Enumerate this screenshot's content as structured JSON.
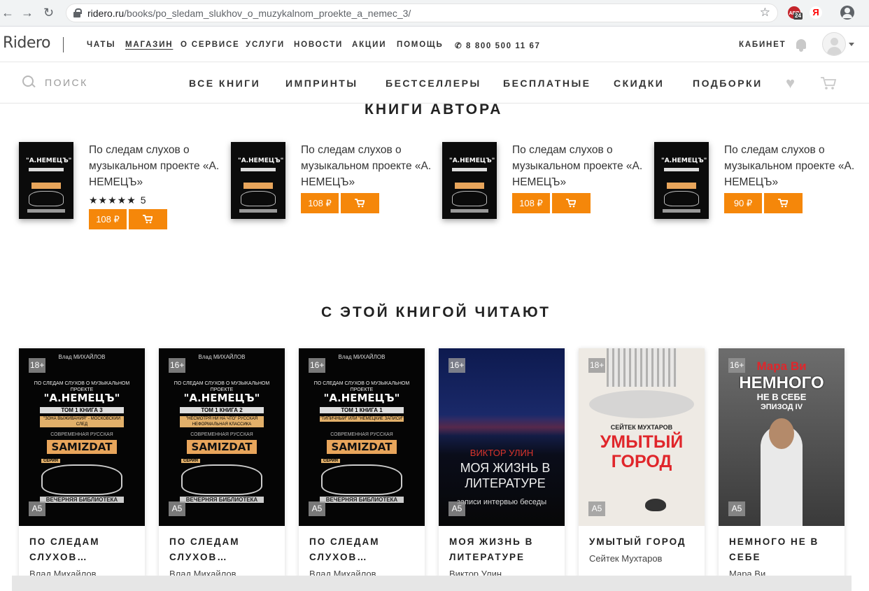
{
  "browser": {
    "url_host": "ridero.ru",
    "url_path": "/books/po_sledam_slukhov_o_muzykalnom_proekte_a_nemec_3/",
    "ext_abp_label": "ABP",
    "ext_abp_count": "24",
    "ext_ya_label": "Я"
  },
  "site": {
    "logo": "Ridero",
    "topnav": [
      "ЧАТЫ",
      "МАГАЗИН",
      "О СЕРВИСЕ",
      "УСЛУГИ",
      "НОВОСТИ",
      "АКЦИИ",
      "ПОМОЩЬ"
    ],
    "phone": "8 800 500 11 67",
    "cabinet": "КАБИНЕТ",
    "search_label": "ПОИСК",
    "shopnav": [
      "ВСЕ КНИГИ",
      "ИМПРИНТЫ",
      "БЕСТСЕЛЛЕРЫ",
      "БЕСПЛАТНЫЕ",
      "СКИДКИ",
      "ПОДБОРКИ"
    ]
  },
  "author_books": {
    "heading": "КНИГИ АВТОРА",
    "items": [
      {
        "title": "По следам слухов о музыкальном проекте «А. НЕМЕЦЪ»",
        "rating_stars": "★★★★★",
        "rating_count": "5",
        "price": "108 ₽",
        "cover_volume": "3"
      },
      {
        "title": "По следам слухов о музыкальном проекте «А. НЕМЕЦЪ»",
        "price": "108 ₽",
        "cover_volume": "3"
      },
      {
        "title": "По следам слухов о музыкальном проекте «А. НЕМЕЦЪ»",
        "price": "108 ₽",
        "cover_volume": "4"
      },
      {
        "title": "По следам слухов о музыкальном проекте «А. НЕМЕЦЪ»",
        "price": "90 ₽",
        "cover_volume": "1"
      }
    ]
  },
  "read_with": {
    "heading": "С ЭТОЙ КНИГОЙ ЧИТАЮТ",
    "items": [
      {
        "age": "18+",
        "format": "A5",
        "title": "ПО СЛЕДАМ СЛУХОВ…",
        "author": "Влад Михайлов",
        "cover": {
          "author": "Влад МИХАЙЛОВ",
          "line1": "ПО СЛЕДАМ СЛУХОВ О МУЗЫКАЛЬНОМ ПРОЕКТЕ",
          "name": "\"А.НЕМЕЦЪ\"",
          "vol": "ТОМ 1 КНИГА 3",
          "sub": "\"ЗОНА ВЫЖИВАНИЯ\" - МОСКОВСКИЙ СЛЕД",
          "series_top": "СОВРЕМЕННАЯ РУССКАЯ",
          "series": "SAMIZDAT",
          "seria": "СЕРИЯ",
          "library": "ВЕЧЕРНЯЯ БИБЛИОТЕКА"
        }
      },
      {
        "age": "16+",
        "format": "A5",
        "title": "ПО СЛЕДАМ СЛУХОВ…",
        "author": "Влад Михайлов",
        "cover": {
          "author": "Влад МИХАЙЛОВ",
          "line1": "ПО СЛЕДАМ СЛУХОВ О МУЗЫКАЛЬНОМ ПРОЕКТЕ",
          "name": "\"А.НЕМЕЦЪ\"",
          "vol": "ТОМ 1 КНИГА 2",
          "sub": "\"НЕСМОТРЯ НИ НА ЧТО\" РУССКАЯ НЕФОРМАЛЬНАЯ КЛАССИКА",
          "series_top": "СОВРЕМЕННАЯ РУССКАЯ",
          "series": "SAMIZDAT",
          "seria": "СЕРИЯ",
          "library": "ВЕЧЕРНЯЯ БИБЛИОТЕКА"
        }
      },
      {
        "age": "16+",
        "format": "A5",
        "title": "ПО СЛЕДАМ СЛУХОВ…",
        "author": "Влад Михайлов",
        "cover": {
          "author": "Влад МИХАЙЛОВ",
          "line1": "ПО СЛЕДАМ СЛУХОВ О МУЗЫКАЛЬНОМ ПРОЕКТЕ",
          "name": "\"А.НЕМЕЦЪ\"",
          "vol": "ТОМ 1 КНИГА 1",
          "sub": "\"ТИПИЧНЫЙ\" ИЛИ \"НЕМЕЦКИЕ ЗАПИСИ\"",
          "series_top": "СОВРЕМЕННАЯ РУССКАЯ",
          "series": "SAMIZDAT",
          "seria": "СЕРИЯ",
          "library": "ВЕЧЕРНЯЯ БИБЛИОТЕКА"
        }
      },
      {
        "age": "16+",
        "format": "A5",
        "title": "МОЯ ЖИЗНЬ В ЛИТЕРАТУРЕ",
        "author": "Виктор Улин",
        "cover": {
          "author": "ВИКТОР УЛИН",
          "title": "МОЯ ЖИЗНЬ В ЛИТЕРАТУРЕ",
          "sub": "записи интервью беседы"
        }
      },
      {
        "age": "18+",
        "format": "A5",
        "title": "УМЫТЫЙ ГОРОД",
        "author": "Сейтек Мухтаров",
        "cover": {
          "author": "СЕЙТЕК МУХТАРОВ",
          "title": "УМЫТЫЙ ГОРОД"
        }
      },
      {
        "age": "16+",
        "format": "A5",
        "title": "НЕМНОГО НЕ В СЕБЕ",
        "author": "Мара Ви",
        "cover": {
          "author": "Мара Ви",
          "title": "НЕМНОГО",
          "title2": "НЕ В СЕБЕ",
          "episode": "ЭПИЗОД IV"
        }
      }
    ]
  },
  "colors": {
    "accent": "#f5870a",
    "text": "#222222",
    "muted": "#999999"
  }
}
